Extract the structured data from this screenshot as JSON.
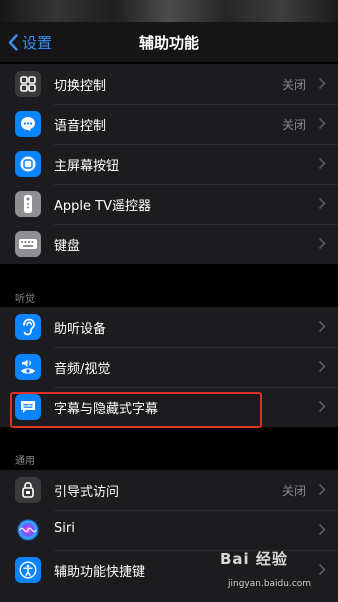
{
  "nav": {
    "back_label": "设置",
    "title": "辅助功能"
  },
  "sections": {
    "hearing_header": "听觉",
    "general_header": "通用"
  },
  "interaction_items": [
    {
      "label": "切换控制",
      "value": "关闭",
      "icon": "switch-control-icon",
      "color": "#3a3a3c"
    },
    {
      "label": "语音控制",
      "value": "关闭",
      "icon": "voice-control-icon",
      "color": "#0a84ff"
    },
    {
      "label": "主屏幕按钮",
      "value": "",
      "icon": "home-button-icon",
      "color": "#0a84ff"
    },
    {
      "label": "Apple TV遥控器",
      "value": "",
      "icon": "remote-icon",
      "color": "#8e8e93"
    },
    {
      "label": "键盘",
      "value": "",
      "icon": "keyboard-icon",
      "color": "#8e8e93"
    }
  ],
  "hearing_items": [
    {
      "label": "助听设备",
      "value": "",
      "icon": "ear-icon",
      "color": "#0a84ff"
    },
    {
      "label": "音频/视觉",
      "value": "",
      "icon": "audio-visual-icon",
      "color": "#0a84ff"
    },
    {
      "label": "字幕与隐藏式字幕",
      "value": "",
      "icon": "subtitles-icon",
      "color": "#0a84ff"
    }
  ],
  "general_items": [
    {
      "label": "引导式访问",
      "value": "关闭",
      "icon": "guided-access-icon",
      "color": "#3a3a3c"
    },
    {
      "label": "Siri",
      "value": "",
      "icon": "siri-icon",
      "color": "#1c1c1e"
    },
    {
      "label": "辅助功能快捷键",
      "value": "",
      "icon": "accessibility-icon",
      "color": "#0a84ff"
    }
  ],
  "watermark": {
    "logo": "Bai 经验",
    "url": "jingyan.baidu.com"
  }
}
